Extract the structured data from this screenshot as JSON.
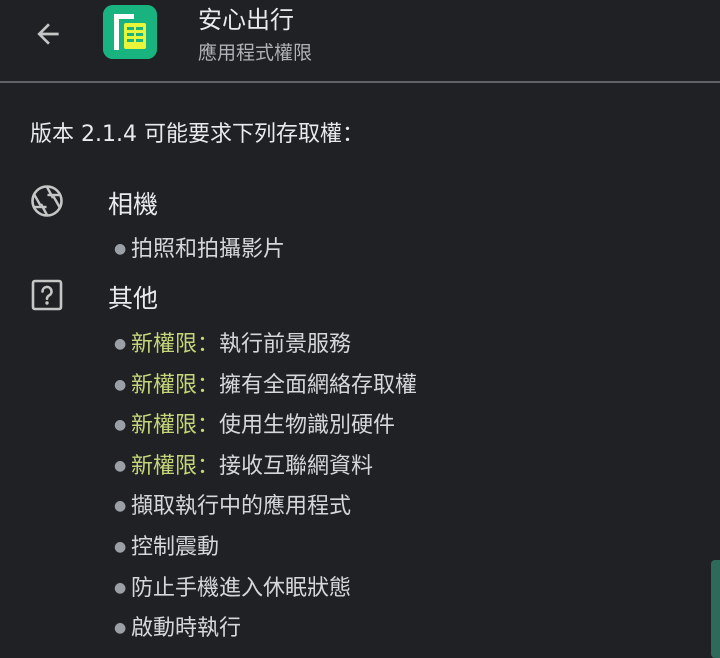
{
  "header": {
    "back_icon": "arrow-back-icon",
    "app_icon": "app-logo-icon",
    "app_icon_color": "#19b37f",
    "app_name": "安心出行",
    "subtitle": "應用程式權限"
  },
  "intro": "版本 2.1.4 可能要求下列存取權：",
  "groups": [
    {
      "icon": "camera-aperture-icon",
      "title": "相機",
      "permissions": [
        {
          "new_label": "",
          "text": "拍照和拍攝影片"
        }
      ]
    },
    {
      "icon": "question-box-icon",
      "title": "其他",
      "permissions": [
        {
          "new_label": "新權限：",
          "text": "執行前景服務"
        },
        {
          "new_label": "新權限：",
          "text": "擁有全面網絡存取權"
        },
        {
          "new_label": "新權限：",
          "text": "使用生物識別硬件"
        },
        {
          "new_label": "新權限：",
          "text": "接收互聯網資料"
        },
        {
          "new_label": "",
          "text": "擷取執行中的應用程式"
        },
        {
          "new_label": "",
          "text": "控制震動"
        },
        {
          "new_label": "",
          "text": "防止手機進入休眠狀態"
        },
        {
          "new_label": "",
          "text": "啟動時執行"
        }
      ]
    }
  ],
  "colors": {
    "background": "#202124",
    "new_permission": "#c5d67a",
    "text": "#e8eaed"
  }
}
